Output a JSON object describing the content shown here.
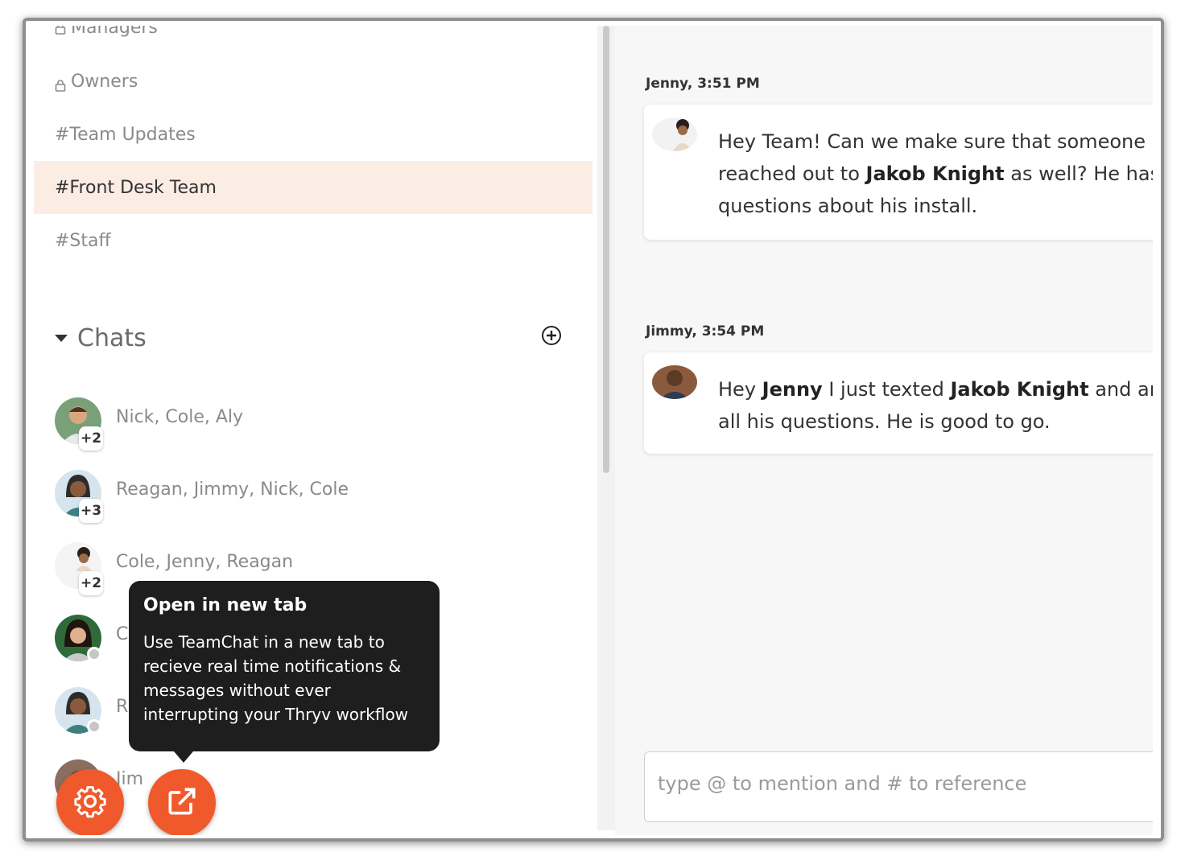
{
  "sidebar": {
    "cut_item": "Managers",
    "channels": [
      {
        "label": "Owners",
        "locked": true,
        "active": false
      },
      {
        "label": "#Team Updates",
        "locked": false,
        "active": false
      },
      {
        "label": "#Front Desk Team",
        "locked": false,
        "active": true
      },
      {
        "label": "#Staff",
        "locked": false,
        "active": false
      }
    ],
    "chats_title": "Chats",
    "chats": [
      {
        "name": "Nick, Cole, Aly",
        "badge": "+2"
      },
      {
        "name": "Reagan, Jimmy, Nick, Cole",
        "badge": "+3"
      },
      {
        "name": "Cole, Jenny, Reagan",
        "badge": "+2"
      },
      {
        "name": "C",
        "badge": ""
      },
      {
        "name": "R",
        "badge": ""
      },
      {
        "name": "Jim",
        "badge": ""
      }
    ]
  },
  "tooltip": {
    "title": "Open in new tab",
    "body": "Use TeamChat in a new tab to recieve real time notifications & messages without ever interrupting your Thryv workflow"
  },
  "actions": {
    "settings_icon": "gear-icon",
    "open_new_tab_icon": "external-link-icon"
  },
  "messages": [
    {
      "meta": "Jenny, 3:51 PM",
      "lines": [
        "Hey Team! Can we make sure that someone",
        "reached out to ",
        "Jakob Knight",
        " as well? He has",
        "questions about his install."
      ]
    },
    {
      "meta": "Jimmy, 3:54 PM",
      "lines": [
        "Hey ",
        "Jenny",
        "  I just texted ",
        "Jakob Knight",
        " and an",
        "all his questions. He is good to go."
      ]
    }
  ],
  "composer": {
    "placeholder": "type @ to mention and # to reference"
  },
  "colors": {
    "accent": "#f0592b",
    "active_row": "#fbece4",
    "tooltip_bg": "#1e1e1e"
  }
}
